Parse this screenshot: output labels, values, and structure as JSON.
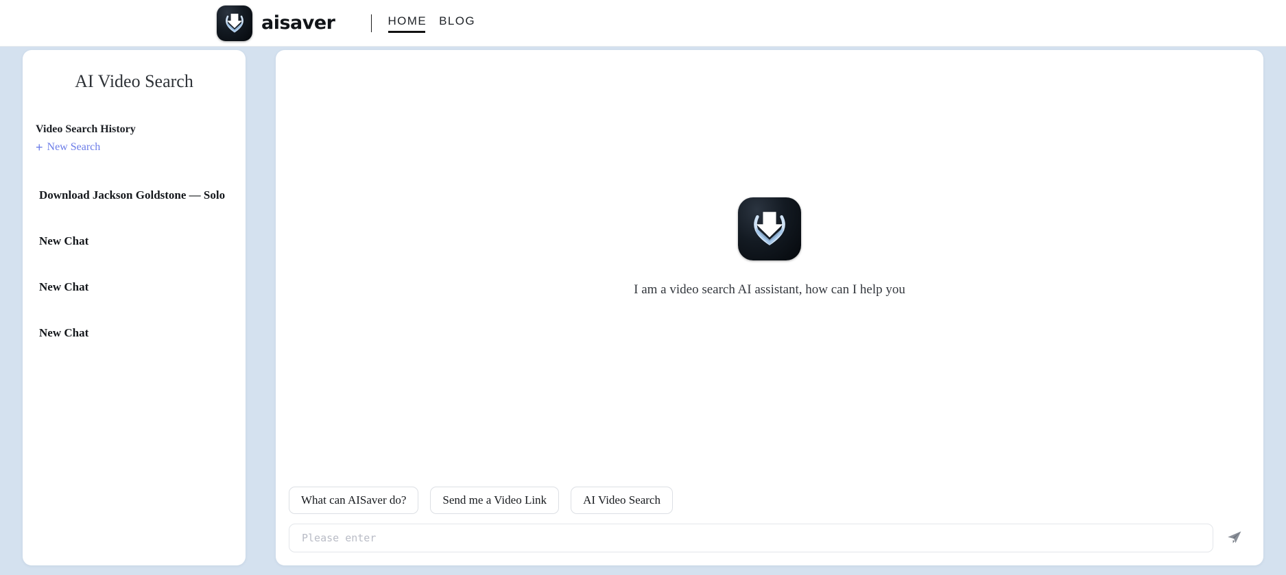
{
  "header": {
    "logo_icon": "download-arrow-logo",
    "brand_name": "aisaver",
    "divider": "|",
    "nav": [
      {
        "label": "HOME",
        "active": true
      },
      {
        "label": "BLOG",
        "active": false
      }
    ]
  },
  "sidebar": {
    "title": "AI Video Search",
    "history_label": "Video Search History",
    "new_search": {
      "icon": "plus-icon",
      "label": "New Search",
      "color": "#6b7ce8"
    },
    "history_items": [
      {
        "label": "Download Jackson Goldstone — Solo"
      },
      {
        "label": "New Chat"
      },
      {
        "label": "New Chat"
      },
      {
        "label": "New Chat"
      }
    ]
  },
  "main": {
    "empty_state": {
      "logo_icon": "download-arrow-logo",
      "greeting": "I am a video search AI assistant, how can I help you"
    },
    "suggestion_chips": [
      {
        "label": "What can AISaver do?"
      },
      {
        "label": "Send me a Video Link"
      },
      {
        "label": "AI Video Search"
      }
    ],
    "composer": {
      "placeholder": "Please enter",
      "value": "",
      "send_icon": "send-paper-plane-icon"
    }
  },
  "colors": {
    "page_background": "#d4e1ef",
    "panel_background": "#ffffff",
    "accent_link": "#6b7ce8",
    "logo_dark": "#0b1117",
    "logo_chevron": "#bcd6ef"
  }
}
